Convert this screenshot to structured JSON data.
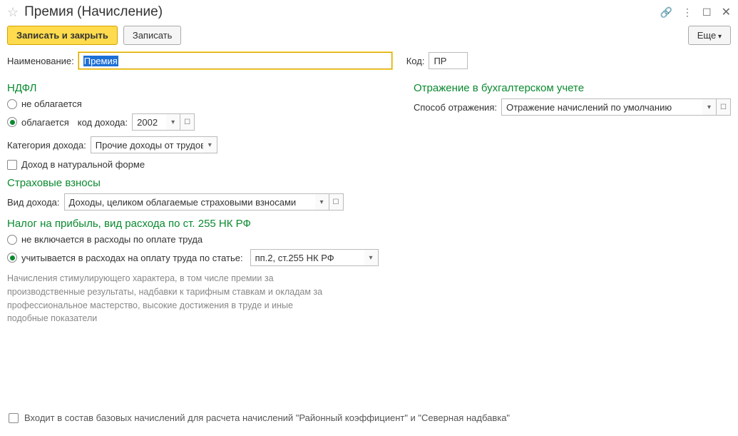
{
  "title": "Премия (Начисление)",
  "toolbar": {
    "save_close": "Записать и закрыть",
    "save": "Записать",
    "more": "Еще"
  },
  "fields": {
    "name_label": "Наименование:",
    "name_value": "Премия",
    "code_label": "Код:",
    "code_value": "ПР"
  },
  "ndfl": {
    "title": "НДФЛ",
    "opt_not_taxed": "не облагается",
    "opt_taxed": "облагается",
    "income_code_label": "код дохода:",
    "income_code_value": "2002",
    "category_label": "Категория дохода:",
    "category_value": "Прочие доходы от трудов",
    "natural_form": "Доход в натуральной форме"
  },
  "insurance": {
    "title": "Страховые взносы",
    "label": "Вид дохода:",
    "value": "Доходы, целиком облагаемые страховыми взносами"
  },
  "profit_tax": {
    "title": "Налог на прибыль, вид расхода по ст. 255 НК РФ",
    "opt_not_included": "не включается в расходы по оплате труда",
    "opt_included": "учитывается в расходах на оплату труда по статье:",
    "article_value": "пп.2, ст.255 НК РФ",
    "hint": "Начисления стимулирующего характера, в том числе премии за производственные результаты, надбавки к тарифным ставкам и окладам за профессиональное мастерство, высокие достижения в труде и иные подобные показатели"
  },
  "accounting": {
    "title": "Отражение в бухгалтерском учете",
    "label": "Способ отражения:",
    "value": "Отражение начислений по умолчанию"
  },
  "bottom_check": "Входит в состав базовых начислений для расчета начислений \"Районный коэффициент\" и \"Северная надбавка\""
}
